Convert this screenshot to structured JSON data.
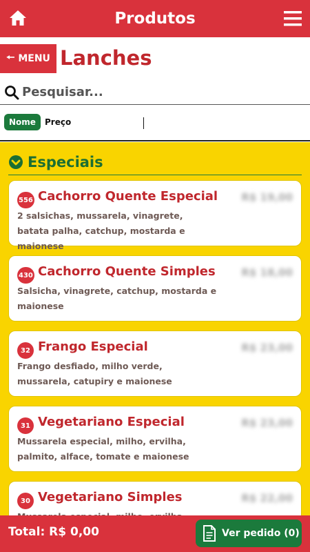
{
  "header": {
    "title": "Produtos",
    "home_icon": "home-icon",
    "menu_icon": "hamburger-menu-icon"
  },
  "subheader": {
    "back_label": "MENU",
    "back_icon": "arrow-left-icon",
    "title": "Lanches"
  },
  "search": {
    "placeholder": "Pesquisar...",
    "value": ""
  },
  "sort": {
    "name_label": "Nome",
    "price_label": "Preço",
    "active": "Nome"
  },
  "section": {
    "title": "Especiais",
    "icon": "chevron-down-circle-icon"
  },
  "items": [
    {
      "badge": "556",
      "name": "Cachorro Quente Especial",
      "price": "R$ 19,00",
      "desc": "2 salsichas, mussarela, vinagrete, batata palha, catchup, mostarda e maionese"
    },
    {
      "badge": "430",
      "name": "Cachorro Quente Simples",
      "price": "R$ 18,00",
      "desc": "Salsicha, vinagrete, catchup, mostarda e maionese"
    },
    {
      "badge": "32",
      "name": "Frango Especial",
      "price": "R$ 23,00",
      "desc": "Frango desfiado, milho verde, mussarela, catupiry e maionese"
    },
    {
      "badge": "31",
      "name": "Vegetariano Especial",
      "price": "R$ 23,00",
      "desc": "Mussarela especial, milho, ervilha, palmito, alface, tomate e maionese"
    },
    {
      "badge": "30",
      "name": "Vegetariano Simples",
      "price": "R$ 22,00",
      "desc": "Mussarela especial, milho, ervilha, alface,"
    }
  ],
  "footer": {
    "total": "Total: R$ 0,00",
    "order_label": "Ver pedido (0)",
    "order_icon": "document-icon"
  },
  "colors": {
    "primary_red": "#d9323c",
    "title_red": "#c0272d",
    "green": "#1b7a3c",
    "yellow": "#f9d400"
  }
}
